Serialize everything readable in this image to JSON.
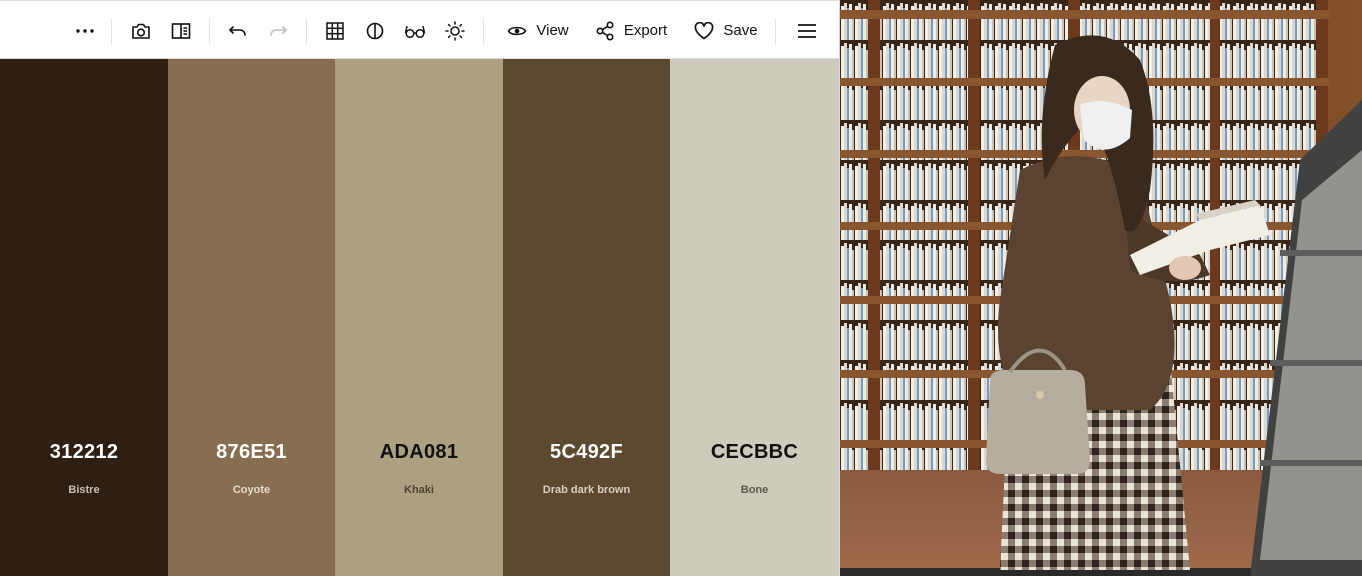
{
  "toolbar": {
    "more_icon": "ellipsis-icon",
    "view_label": "View",
    "export_label": "Export",
    "save_label": "Save"
  },
  "palette": [
    {
      "hex": "312212",
      "name": "Bistre",
      "color": "#2f1f12",
      "text_color": "#ffffff",
      "sub_color": "#c9bfb4"
    },
    {
      "hex": "876E51",
      "name": "Coyote",
      "color": "#876e51",
      "text_color": "#ffffff",
      "sub_color": "#e6dccf"
    },
    {
      "hex": "ADA081",
      "name": "Khaki",
      "color": "#ada081",
      "text_color": "#111111",
      "sub_color": "#4b4434"
    },
    {
      "hex": "5C492F",
      "name": "Drab dark brown",
      "color": "#5c492f",
      "text_color": "#ffffff",
      "sub_color": "#d9cfc0"
    },
    {
      "hex": "CECBBC",
      "name": "Bone",
      "color": "#cecbbc",
      "text_color": "#111111",
      "sub_color": "#5a574b"
    }
  ],
  "photo": {
    "subject": "woman in face mask reading a book in a library"
  }
}
